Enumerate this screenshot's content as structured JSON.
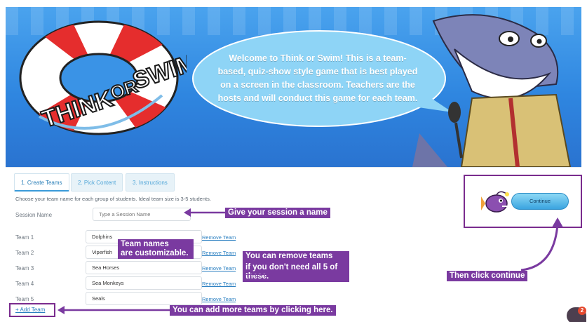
{
  "hero": {
    "logo_text_think": "THINK",
    "logo_text_or": "OR",
    "logo_text_swim": "SWIM!",
    "welcome": "Welcome to Think or Swim! This is a team-based, quiz-show style game that is best played on a screen in the classroom. Teachers are the hosts and will conduct this game for each team."
  },
  "tabs": [
    {
      "label": "1. Create Teams",
      "active": true
    },
    {
      "label": "2. Pick Content",
      "active": false
    },
    {
      "label": "3. Instructions",
      "active": false
    }
  ],
  "instructions": "Choose your team name for each group of students. Ideal team size is 3-5 students.",
  "session": {
    "label": "Session Name",
    "placeholder": "Type a Session Name"
  },
  "teams": [
    {
      "label": "Team 1",
      "value": "Dolphins",
      "remove": "Remove Team"
    },
    {
      "label": "Team 2",
      "value": "Viperfish",
      "remove": "Remove Team"
    },
    {
      "label": "Team 3",
      "value": "Sea Horses",
      "remove": "Remove Team"
    },
    {
      "label": "Team 4",
      "value": "Sea Monkeys",
      "remove": "Remove Team"
    },
    {
      "label": "Team 5",
      "value": "Seals",
      "remove": "Remove Team"
    }
  ],
  "add_team": "+ Add Team",
  "continue_label": "Continue",
  "chat_count": "2",
  "annotations": {
    "session": "Give your session a name",
    "names_line1": "Team names",
    "names_line2": "are customizable.",
    "remove_line1": "You can remove teams",
    "remove_line2": "if you don't need all 5 of these.",
    "add": "You can add more teams by clicking here.",
    "continue": "Then click continue"
  },
  "colors": {
    "annotation_purple": "#7a3aa0",
    "hero_blue": "#3a93e6",
    "link_blue": "#2a7fc1"
  }
}
